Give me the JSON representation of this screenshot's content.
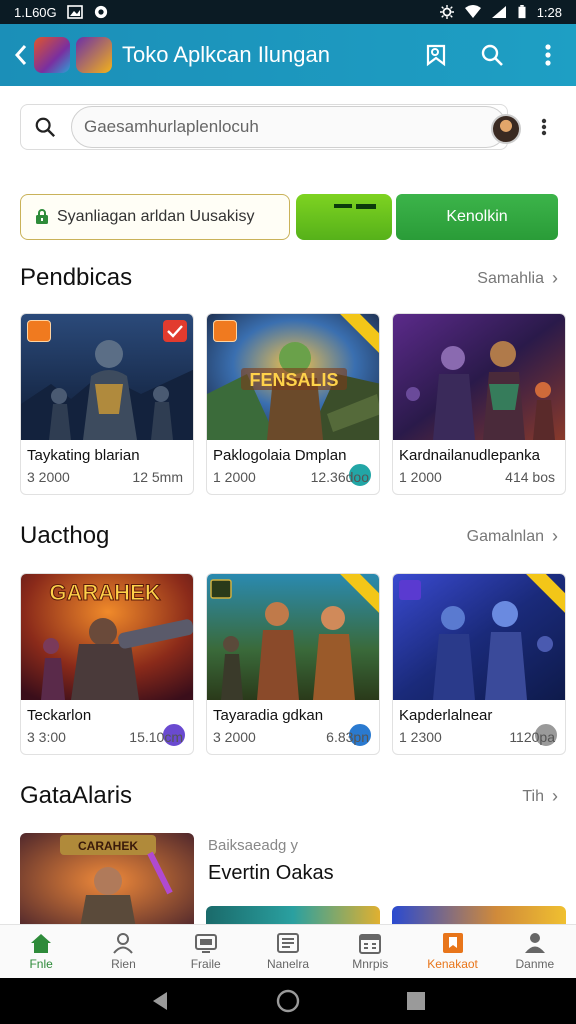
{
  "status_bar": {
    "time_left": "1.L60G",
    "time_right": "1:28"
  },
  "app_bar": {
    "title": "Toko Aplkcan Ilungan"
  },
  "search": {
    "placeholder": "Gaesamhurlaplenlocuh"
  },
  "promo": {
    "notice": "Syanliagan arldan Uusakisy",
    "button_label": "Kenolkin"
  },
  "sections": [
    {
      "title": "Pendbicas",
      "link": "Samahlia",
      "cards": [
        {
          "name": "Taykating blarian",
          "price": "3 2000",
          "size": "12 5mm"
        },
        {
          "name": "Paklogolaia Dmplan",
          "price": "1 2000",
          "size": "12.36doo"
        },
        {
          "name": "Kardnailanudlepanka",
          "price": "1 2000",
          "size": "414 bos"
        }
      ]
    },
    {
      "title": "Uacthog",
      "link": "Gamalnlan",
      "cards": [
        {
          "name": "Teckarlon",
          "price": "3 3:00",
          "size": "15.10cm"
        },
        {
          "name": "Tayaradia gdkan",
          "price": "3 2000",
          "size": "6.83pn"
        },
        {
          "name": "Kapderlalnear",
          "price": "1 2300",
          "size": "1120pa"
        }
      ]
    }
  ],
  "featured": {
    "title": "GataAlaris",
    "link": "Tih",
    "subtitle": "Baiksaeadg y",
    "headline": "Evertin Oakas",
    "thumb_text": "CARAHEK"
  },
  "card_art_text": {
    "game2": "FENSALIS",
    "game4": "GARAHEK"
  },
  "bottom_nav": [
    {
      "label": "Fnle",
      "icon": "home-icon"
    },
    {
      "label": "Rien",
      "icon": "person-icon"
    },
    {
      "label": "Fraile",
      "icon": "tv-icon"
    },
    {
      "label": "Nanelra",
      "icon": "news-icon"
    },
    {
      "label": "Mnrpis",
      "icon": "calendar-icon"
    },
    {
      "label": "Kenakaot",
      "icon": "bookmark-icon"
    },
    {
      "label": "Danme",
      "icon": "account-icon"
    }
  ],
  "colors": {
    "app_bar": "#1b8fb8",
    "accent_green": "#3cb44a",
    "accent_orange": "#e8751a",
    "home_green": "#2e8b3a"
  }
}
